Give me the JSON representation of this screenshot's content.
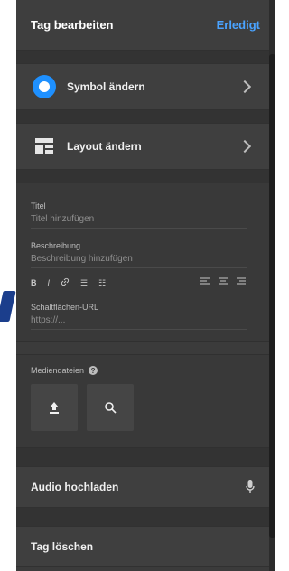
{
  "header": {
    "title": "Tag bearbeiten",
    "done_label": "Erledigt"
  },
  "menu": [
    {
      "label": "Symbol ändern",
      "icon": "symbol-icon"
    },
    {
      "label": "Layout ändern",
      "icon": "layout-icon"
    }
  ],
  "form": {
    "title_label": "Titel",
    "title_placeholder": "Titel hinzufügen",
    "description_label": "Beschreibung",
    "description_placeholder": "Beschreibung hinzufügen",
    "toolbar": {
      "bold": "B",
      "italic": "I",
      "link": "link-icon",
      "bulleted": "☰",
      "numbered": "☷",
      "align_left": "left-align-icon",
      "align_center": "center-align-icon",
      "align_right": "right-align-icon"
    },
    "url_label": "Schaltflächen-URL",
    "url_placeholder": "https://..."
  },
  "media": {
    "label": "Mediendateien",
    "help": "?"
  },
  "audio": {
    "label": "Audio hochladen"
  },
  "delete": {
    "label": "Tag löschen"
  },
  "colors": {
    "accent": "#1e90ff",
    "done": "#4aa3ff",
    "panel": "#3b3b3b"
  }
}
